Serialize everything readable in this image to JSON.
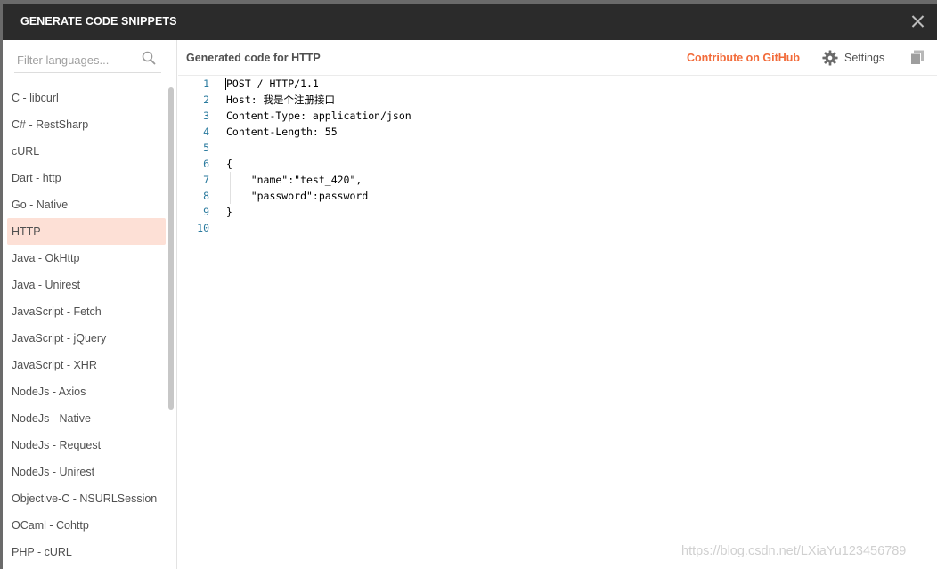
{
  "header": {
    "title": "GENERATE CODE SNIPPETS"
  },
  "sidebar": {
    "filter_placeholder": "Filter languages...",
    "languages": [
      "C - libcurl",
      "C# - RestSharp",
      "cURL",
      "Dart - http",
      "Go - Native",
      "HTTP",
      "Java - OkHttp",
      "Java - Unirest",
      "JavaScript - Fetch",
      "JavaScript - jQuery",
      "JavaScript - XHR",
      "NodeJs - Axios",
      "NodeJs - Native",
      "NodeJs - Request",
      "NodeJs - Unirest",
      "Objective-C - NSURLSession",
      "OCaml - Cohttp",
      "PHP - cURL"
    ],
    "selected": "HTTP"
  },
  "content": {
    "title": "Generated code for HTTP",
    "github_label": "Contribute on GitHub",
    "settings_label": "Settings"
  },
  "code": {
    "lines": [
      "POST / HTTP/1.1",
      "Host: 我是个注册接口",
      "Content-Type: application/json",
      "Content-Length: 55",
      "",
      "{",
      "    \"name\":\"test_420\",",
      "    \"password\":password",
      "}",
      ""
    ],
    "line_numbers": [
      "1",
      "2",
      "3",
      "4",
      "5",
      "6",
      "7",
      "8",
      "9",
      "10"
    ]
  },
  "watermark": "https://blog.csdn.net/LXiaYu123456789",
  "colors": {
    "accent": "#f26b3a",
    "header_bg": "#2b2b2b",
    "selected_bg": "#fde0d6",
    "line_number": "#2a7a9e"
  }
}
